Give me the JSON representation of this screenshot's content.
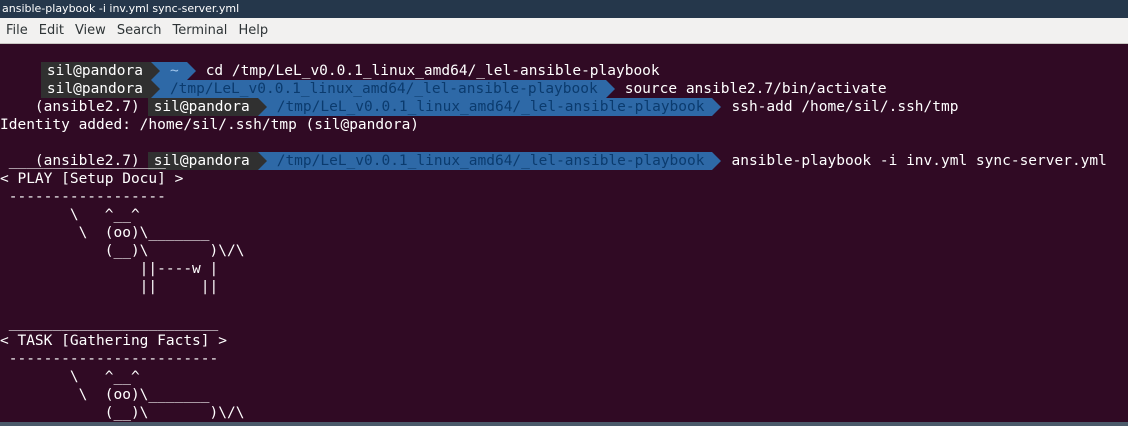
{
  "window": {
    "title": "ansible-playbook -i inv.yml sync-server.yml"
  },
  "menu": [
    "File",
    "Edit",
    "View",
    "Search",
    "Terminal",
    "Help"
  ],
  "prompt": {
    "user_host": "sil@pandora",
    "home_dir": "~",
    "cwd": "/tmp/LeL_v0.0.1_linux_amd64/_lel-ansible-playbook",
    "venv": "(ansible2.7)"
  },
  "commands": {
    "c1": "cd /tmp/LeL_v0.0.1_linux_amd64/_lel-ansible-playbook",
    "c2": "source ansible2.7/bin/activate",
    "c3": "ssh-add /home/sil/.ssh/tmp",
    "c4": "ansible-playbook -i inv.yml sync-server.yml"
  },
  "output": {
    "identity": "Identity added: /home/sil/.ssh/tmp (sil@pandora)",
    "cowsay_lines": [
      " __________________",
      "< PLAY [Setup Docu] >",
      " ------------------",
      "        \\   ^__^",
      "         \\  (oo)\\_______",
      "            (__)\\       )\\/\\",
      "                ||----w |",
      "                ||     ||",
      "",
      "",
      " ________________________",
      "< TASK [Gathering Facts] >",
      " ------------------------",
      "        \\   ^__^",
      "         \\  (oo)\\_______",
      "            (__)\\       )\\/\\"
    ]
  },
  "colors": {
    "terminal_bg": "#300a24",
    "user_segment": "#303030",
    "dir_segment": "#2e69a7"
  }
}
